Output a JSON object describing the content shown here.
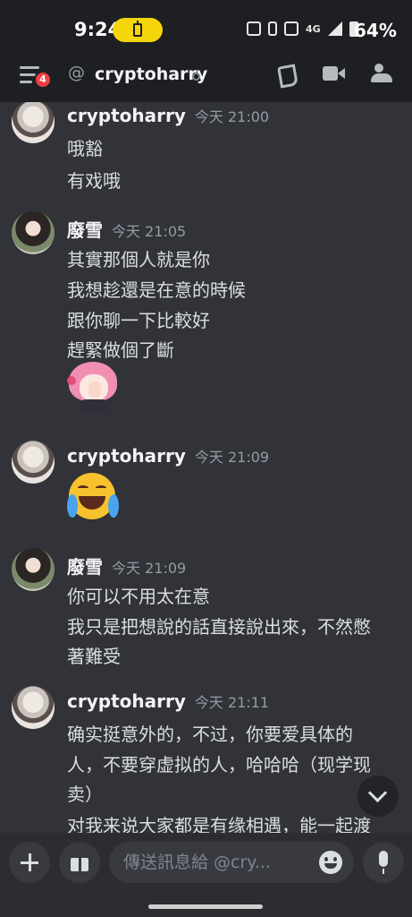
{
  "status_bar": {
    "time": "9:24",
    "network": "4G",
    "battery_percent": "64%",
    "icons": [
      "battery-saver-icon",
      "cast-icon",
      "vibrate-icon",
      "hotspot-icon",
      "signal-icon",
      "battery-icon"
    ]
  },
  "header": {
    "unread_badge": "4",
    "channel_name": "cryptoharry",
    "icons": [
      "menu-icon",
      "at-icon",
      "status-offline-icon",
      "voice-call-icon",
      "video-call-icon",
      "members-icon"
    ]
  },
  "messages": [
    {
      "author": "cryptoharry",
      "timestamp": "今天 21:00",
      "lines": [
        "哦豁",
        "有戏哦"
      ]
    },
    {
      "author": "廢雪",
      "timestamp": "今天 21:05",
      "lines": [
        "其實那個人就是你",
        "我想趁還是在意的時候",
        "跟你聊一下比較好",
        "趕緊做個了斷"
      ],
      "sticker": "pink-hair-anime-girl-sticker"
    },
    {
      "author": "cryptoharry",
      "timestamp": "今天 21:09",
      "emoji": "face-with-tears-of-joy"
    },
    {
      "author": "廢雪",
      "timestamp": "今天 21:09",
      "lines": [
        "你可以不用太在意",
        "我只是把想說的話直接說出來，不然憋",
        "著難受"
      ]
    },
    {
      "author": "cryptoharry",
      "timestamp": "今天 21:11",
      "lines": [
        "确实挺意外的，不过，你要爱具体的",
        "人，不要穿虚拟的人，哈哈哈（现学现",
        "卖）",
        "对我来说大家都是有缘相遇，能一起渡"
      ]
    }
  ],
  "composer": {
    "placeholder": "傳送訊息給 @cry..."
  },
  "colors": {
    "background": "#313338",
    "header": "#1e1f22",
    "badge": "#f23f43",
    "battery_pill": "#f5d60a"
  }
}
